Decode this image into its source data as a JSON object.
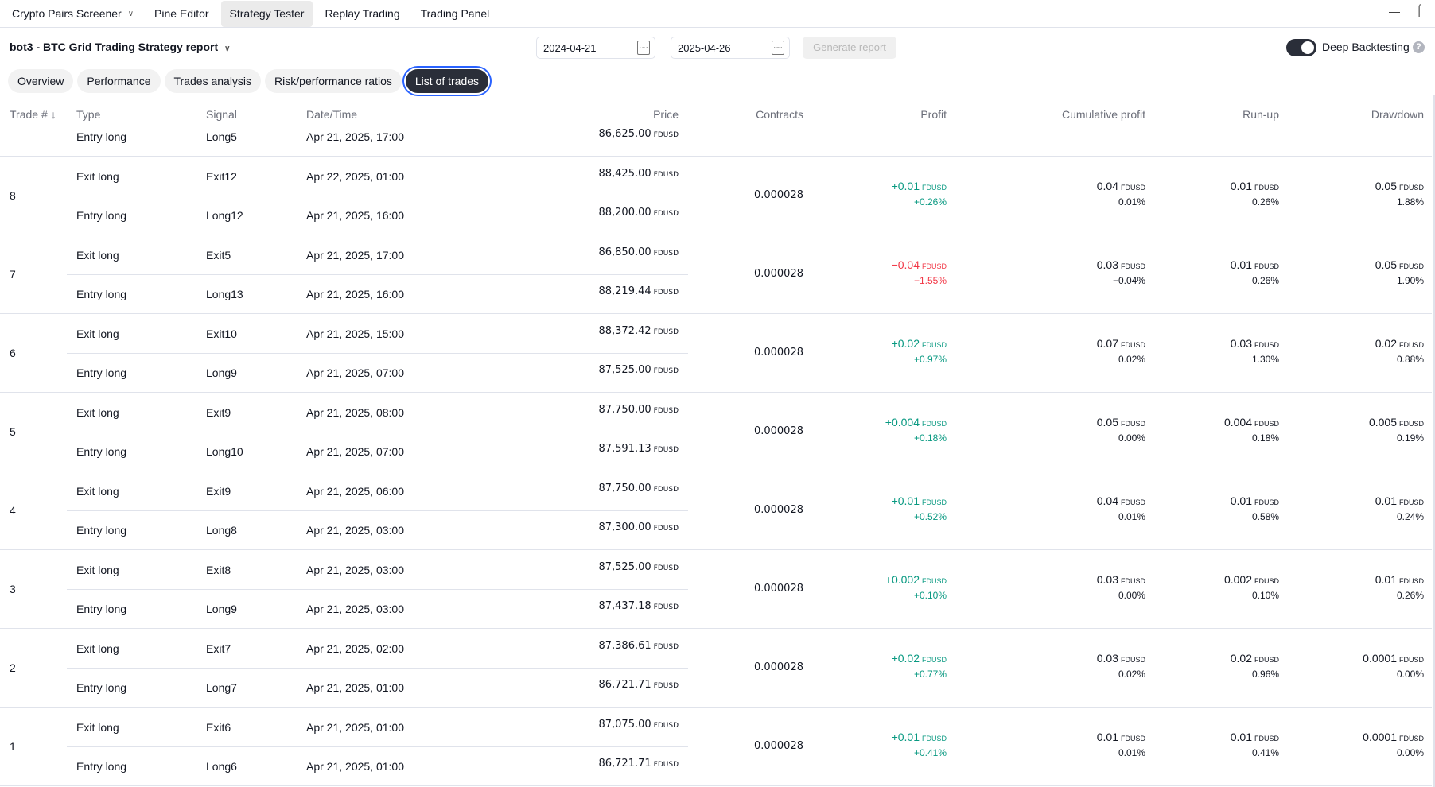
{
  "topbar": {
    "tabs": [
      {
        "label": "Crypto Pairs Screener",
        "dropdown": true
      },
      {
        "label": "Pine Editor"
      },
      {
        "label": "Strategy Tester",
        "active": true
      },
      {
        "label": "Replay Trading"
      },
      {
        "label": "Trading Panel"
      }
    ]
  },
  "report": {
    "title": "bot3 - BTC Grid Trading Strategy report",
    "date_from": "2024-04-21",
    "date_to": "2025-04-26",
    "dash": "–",
    "generate": "Generate report",
    "deep_backtesting": "Deep Backtesting",
    "deep_backtesting_on": true,
    "help": "?"
  },
  "tabs": [
    {
      "label": "Overview"
    },
    {
      "label": "Performance"
    },
    {
      "label": "Trades analysis"
    },
    {
      "label": "Risk/performance ratios"
    },
    {
      "label": "List of trades",
      "active": true
    }
  ],
  "columns": {
    "trade": "Trade # ↓",
    "type": "Type",
    "signal": "Signal",
    "datetime": "Date/Time",
    "price": "Price",
    "contracts": "Contracts",
    "profit": "Profit",
    "cum": "Cumulative profit",
    "runup": "Run-up",
    "drawdown": "Drawdown"
  },
  "currency": "FDUSD",
  "colors": {
    "positive": "#089981",
    "negative": "#f23645",
    "accent": "#2962ff"
  },
  "trades": [
    {
      "no": "",
      "exit": null,
      "entry": {
        "type": "Entry long",
        "signal": "Long5",
        "date": "Apr 21, 2025, 17:00",
        "price": "86,625.00"
      }
    },
    {
      "no": "8",
      "exit": {
        "type": "Exit long",
        "signal": "Exit12",
        "date": "Apr 22, 2025, 01:00",
        "price": "88,425.00"
      },
      "entry": {
        "type": "Entry long",
        "signal": "Long12",
        "date": "Apr 21, 2025, 16:00",
        "price": "88,200.00"
      },
      "contracts": "0.000028",
      "profit": "+0.01",
      "profit_pct": "+0.26%",
      "neg": false,
      "cum": "0.04",
      "cum_pct": "0.01%",
      "runup": "0.01",
      "runup_pct": "0.26%",
      "dd": "0.05",
      "dd_pct": "1.88%"
    },
    {
      "no": "7",
      "exit": {
        "type": "Exit long",
        "signal": "Exit5",
        "date": "Apr 21, 2025, 17:00",
        "price": "86,850.00"
      },
      "entry": {
        "type": "Entry long",
        "signal": "Long13",
        "date": "Apr 21, 2025, 16:00",
        "price": "88,219.44"
      },
      "contracts": "0.000028",
      "profit": "−0.04",
      "profit_pct": "−1.55%",
      "neg": true,
      "cum": "0.03",
      "cum_pct": "−0.04%",
      "runup": "0.01",
      "runup_pct": "0.26%",
      "dd": "0.05",
      "dd_pct": "1.90%"
    },
    {
      "no": "6",
      "exit": {
        "type": "Exit long",
        "signal": "Exit10",
        "date": "Apr 21, 2025, 15:00",
        "price": "88,372.42"
      },
      "entry": {
        "type": "Entry long",
        "signal": "Long9",
        "date": "Apr 21, 2025, 07:00",
        "price": "87,525.00"
      },
      "contracts": "0.000028",
      "profit": "+0.02",
      "profit_pct": "+0.97%",
      "neg": false,
      "cum": "0.07",
      "cum_pct": "0.02%",
      "runup": "0.03",
      "runup_pct": "1.30%",
      "dd": "0.02",
      "dd_pct": "0.88%"
    },
    {
      "no": "5",
      "exit": {
        "type": "Exit long",
        "signal": "Exit9",
        "date": "Apr 21, 2025, 08:00",
        "price": "87,750.00"
      },
      "entry": {
        "type": "Entry long",
        "signal": "Long10",
        "date": "Apr 21, 2025, 07:00",
        "price": "87,591.13"
      },
      "contracts": "0.000028",
      "profit": "+0.004",
      "profit_pct": "+0.18%",
      "neg": false,
      "cum": "0.05",
      "cum_pct": "0.00%",
      "runup": "0.004",
      "runup_pct": "0.18%",
      "dd": "0.005",
      "dd_pct": "0.19%"
    },
    {
      "no": "4",
      "exit": {
        "type": "Exit long",
        "signal": "Exit9",
        "date": "Apr 21, 2025, 06:00",
        "price": "87,750.00"
      },
      "entry": {
        "type": "Entry long",
        "signal": "Long8",
        "date": "Apr 21, 2025, 03:00",
        "price": "87,300.00"
      },
      "contracts": "0.000028",
      "profit": "+0.01",
      "profit_pct": "+0.52%",
      "neg": false,
      "cum": "0.04",
      "cum_pct": "0.01%",
      "runup": "0.01",
      "runup_pct": "0.58%",
      "dd": "0.01",
      "dd_pct": "0.24%"
    },
    {
      "no": "3",
      "exit": {
        "type": "Exit long",
        "signal": "Exit8",
        "date": "Apr 21, 2025, 03:00",
        "price": "87,525.00"
      },
      "entry": {
        "type": "Entry long",
        "signal": "Long9",
        "date": "Apr 21, 2025, 03:00",
        "price": "87,437.18"
      },
      "contracts": "0.000028",
      "profit": "+0.002",
      "profit_pct": "+0.10%",
      "neg": false,
      "cum": "0.03",
      "cum_pct": "0.00%",
      "runup": "0.002",
      "runup_pct": "0.10%",
      "dd": "0.01",
      "dd_pct": "0.26%"
    },
    {
      "no": "2",
      "exit": {
        "type": "Exit long",
        "signal": "Exit7",
        "date": "Apr 21, 2025, 02:00",
        "price": "87,386.61"
      },
      "entry": {
        "type": "Entry long",
        "signal": "Long7",
        "date": "Apr 21, 2025, 01:00",
        "price": "86,721.71"
      },
      "contracts": "0.000028",
      "profit": "+0.02",
      "profit_pct": "+0.77%",
      "neg": false,
      "cum": "0.03",
      "cum_pct": "0.02%",
      "runup": "0.02",
      "runup_pct": "0.96%",
      "dd": "0.0001",
      "dd_pct": "0.00%"
    },
    {
      "no": "1",
      "exit": {
        "type": "Exit long",
        "signal": "Exit6",
        "date": "Apr 21, 2025, 01:00",
        "price": "87,075.00"
      },
      "entry": {
        "type": "Entry long",
        "signal": "Long6",
        "date": "Apr 21, 2025, 01:00",
        "price": "86,721.71"
      },
      "contracts": "0.000028",
      "profit": "+0.01",
      "profit_pct": "+0.41%",
      "neg": false,
      "cum": "0.01",
      "cum_pct": "0.01%",
      "runup": "0.01",
      "runup_pct": "0.41%",
      "dd": "0.0001",
      "dd_pct": "0.00%"
    }
  ]
}
